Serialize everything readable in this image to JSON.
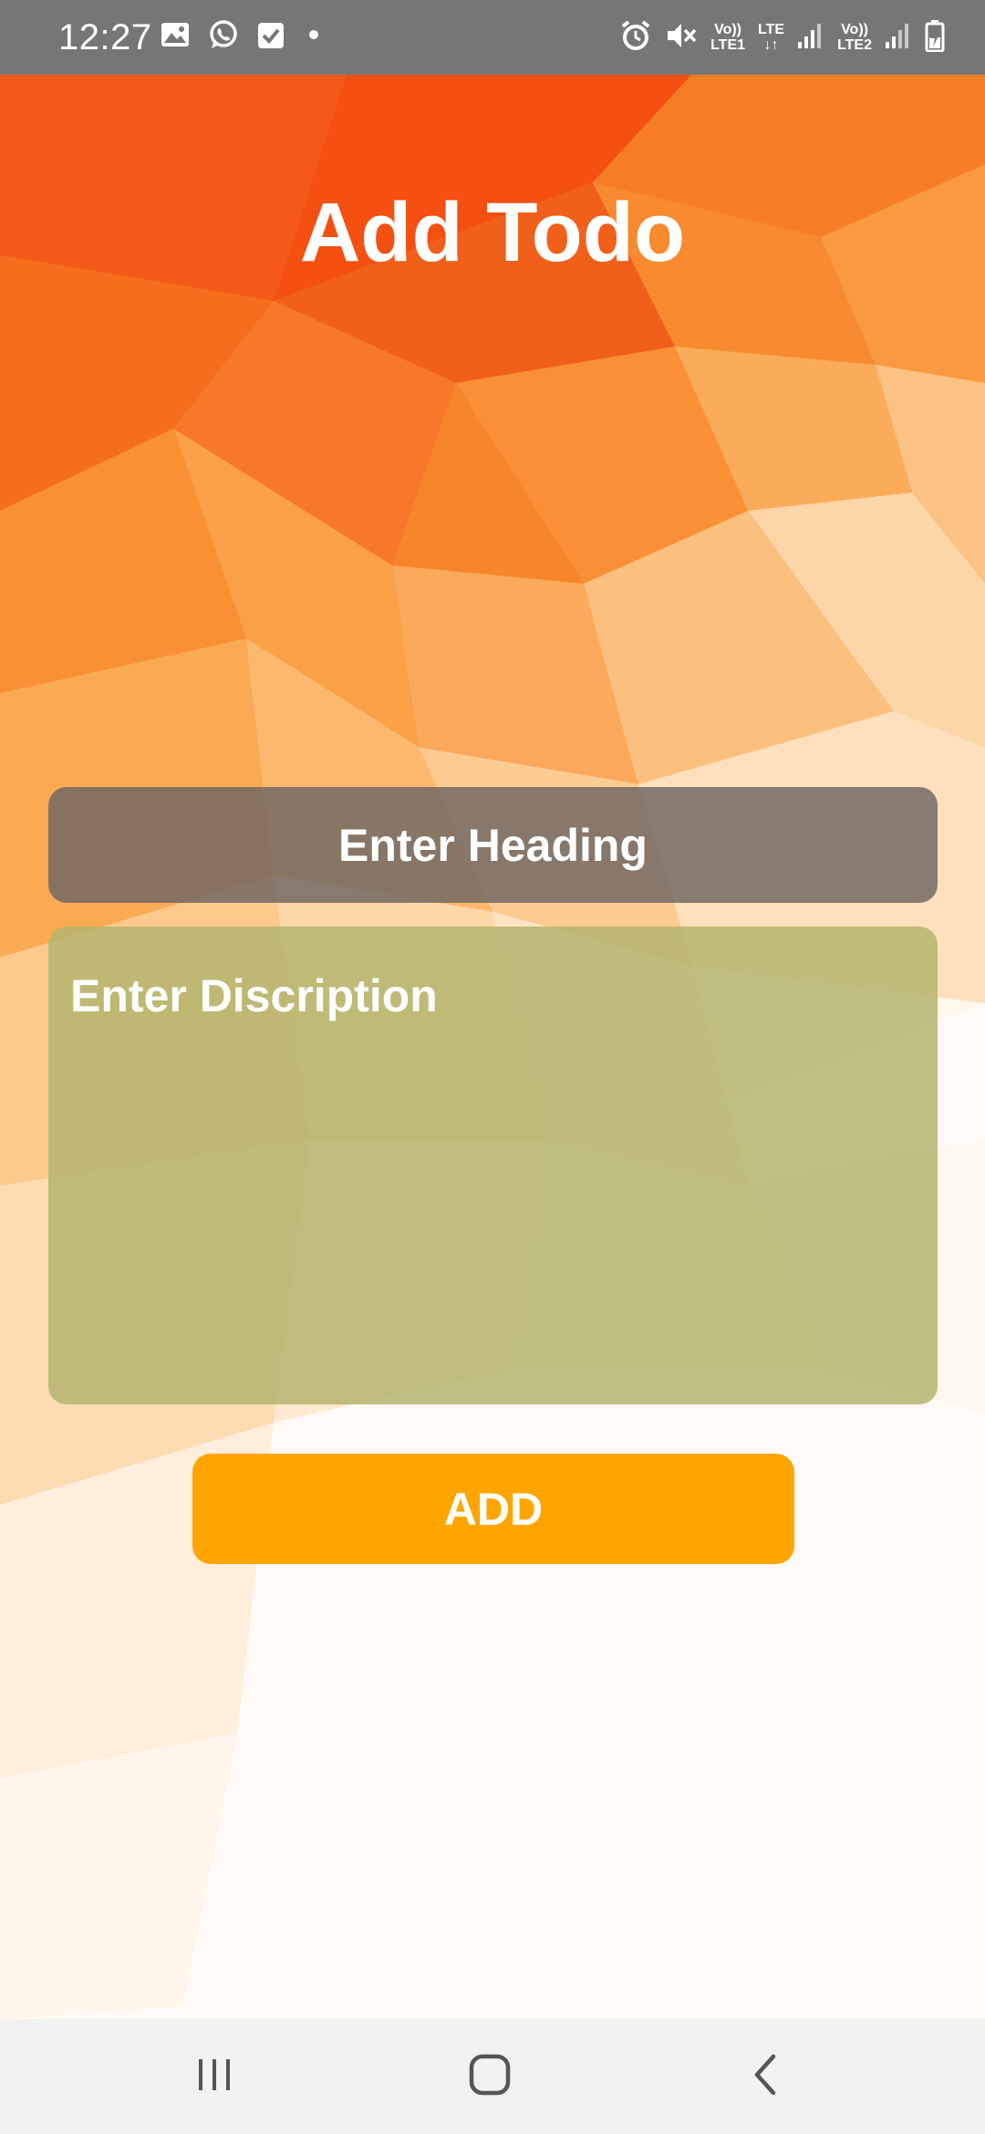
{
  "status_bar": {
    "time": "12:27",
    "sim1_label_top": "Vo))",
    "sim1_label_bottom": "LTE1",
    "lte_label": "LTE",
    "sim2_label_top": "Vo))",
    "sim2_label_bottom": "LTE2",
    "left_icons": [
      "gallery-icon",
      "whatsapp-icon",
      "checkbox-notification-icon",
      "dot-icon"
    ],
    "right_icons": [
      "alarm-icon",
      "mute-icon",
      "signal-icon",
      "battery-charging-icon"
    ]
  },
  "page": {
    "title": "Add Todo"
  },
  "form": {
    "heading_placeholder": "Enter Heading",
    "heading_value": "",
    "description_placeholder": "Enter Discription",
    "description_value": "",
    "add_label": "ADD"
  },
  "nav_bar": {
    "buttons": [
      "recent-apps-icon",
      "home-icon",
      "back-icon"
    ]
  },
  "colors": {
    "status_bar": "#767676",
    "background_orange": "#f58220",
    "background_deep": "#f35a10",
    "heading_box": "#706864",
    "description_box": "#b4b46e",
    "add_button": "#ffa500",
    "nav_bar": "#f2f2f2"
  }
}
